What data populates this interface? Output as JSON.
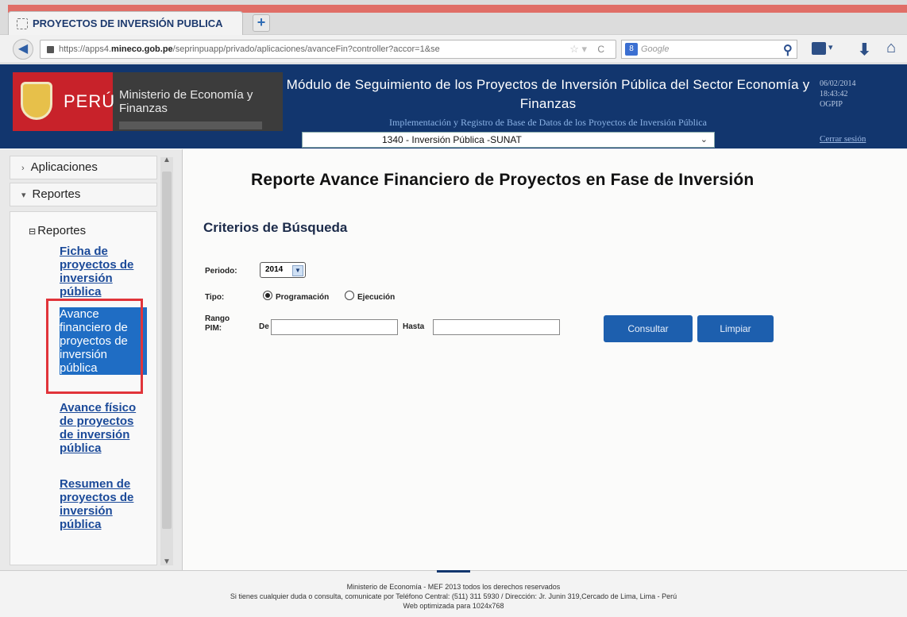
{
  "browser": {
    "tab_title": "PROYECTOS DE INVERSIÓN PUBLICA",
    "new_tab": "+",
    "url_prefix": "https://apps4.",
    "url_host": "mineco.gob.pe",
    "url_path": "/seprinpuapp/privado/aplicaciones/avanceFin?controller?accor=1&se",
    "search_placeholder": "Google",
    "search_engine_badge": "8",
    "icons": [
      "back-arrow-icon",
      "lock-icon",
      "star-icon",
      "reload-icon",
      "search-icon",
      "bookmarks-icon",
      "download-icon",
      "home-icon"
    ]
  },
  "header": {
    "country": "PERÚ",
    "ministry": "Ministerio de Economía y Finanzas",
    "title": "Módulo de Seguimiento de los Proyectos de Inversión Pública del Sector Economía y Finanzas",
    "subtitle": "Implementación y Registro de Base de Datos de los Proyectos de Inversión Pública",
    "date": "06/02/2014",
    "time": "18:43:42",
    "office": "OGPIP",
    "entity": "1340 - Inversión Pública -SUNAT",
    "logout": "Cerrar sesión",
    "colors": {
      "header_bg": "#12366e",
      "logo_red": "#c8222a"
    }
  },
  "sidebar": {
    "applications": "Aplicaciones",
    "reports": "Reportes",
    "tree_root": "Reportes",
    "links": [
      {
        "label": "Ficha de proyectos de inversión pública"
      },
      {
        "label": "Avance financiero de proyectos de inversión pública",
        "selected": true
      },
      {
        "label": "Avance físico de proyectos de inversión pública"
      },
      {
        "label": "Resumen de proyectos de inversión pública"
      }
    ]
  },
  "main": {
    "title": "Reporte Avance Financiero de Proyectos en Fase de Inversión",
    "criteria_heading": "Criterios de Búsqueda",
    "period_label": "Periodo:",
    "period_value": "2014",
    "type_label": "Tipo:",
    "type_options": [
      "Programación",
      "Ejecución"
    ],
    "type_selected": "Programación",
    "range_label": "Rango PIM:",
    "from_label": "De",
    "to_label": "Hasta",
    "from_value": "",
    "to_value": "",
    "query_button": "Consultar",
    "clear_button": "Limpiar",
    "accent": "#1d5fae"
  },
  "footer": {
    "line1": "Ministerio de Economía - MEF 2013 todos los derechos reservados",
    "line2": "Si tienes cualquier duda o consulta, comunicate por Teléfono Central: (511) 311 5930 / Dirección: Jr. Junin 319,Cercado de Lima, Lima - Perú",
    "line3": "Web optimizada para 1024x768"
  }
}
